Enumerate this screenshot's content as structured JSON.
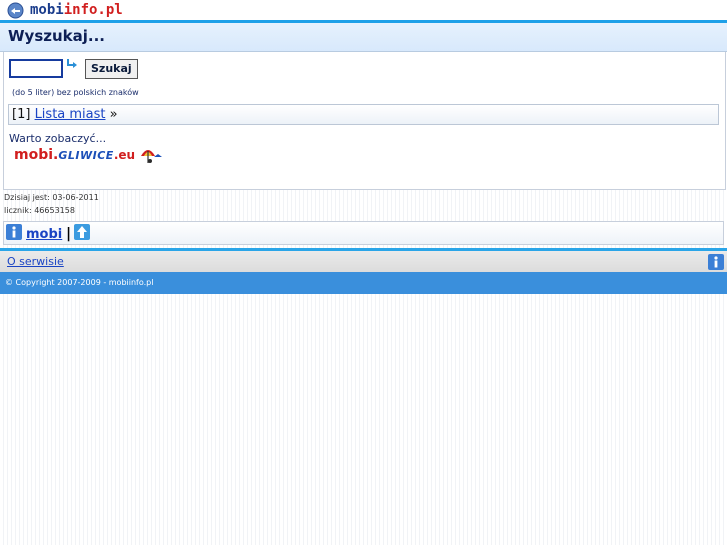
{
  "header": {
    "logo_part1": "mobi",
    "logo_part2": "info.pl",
    "logo_icon": "globe-icon",
    "title": "Wyszukaj..."
  },
  "search": {
    "value": "",
    "button_label": "Szukaj",
    "hint": "(do 5 liter) bez polskich znaków",
    "arrow_icon": "arrow-right-icon"
  },
  "list": {
    "prefix": "[1]",
    "link_label": "Lista miast",
    "suffix": "»"
  },
  "promo": {
    "heading": "Warto zobaczyć...",
    "part1": "mobi.",
    "part2": "GLIWICE",
    "part3": ".eu",
    "icon": "umbrella-icon"
  },
  "stats": {
    "date_line": "Dzisiaj jest: 03-06-2011",
    "counter_line": "licznik: 46653158"
  },
  "nav": {
    "info_icon": "info-icon",
    "link_label": "mobi",
    "separator": "|",
    "up_icon": "arrow-up-icon"
  },
  "about": {
    "link_label": "O serwisie"
  },
  "footer": {
    "copyright": "© Copyright 2007-2009 - mobiinfo.pl"
  },
  "colors": {
    "accent": "#1ea0e8",
    "footer": "#3a8fdc",
    "brand_blue": "#1a3c8c",
    "brand_red": "#d11f1f",
    "link": "#1a44c4"
  }
}
